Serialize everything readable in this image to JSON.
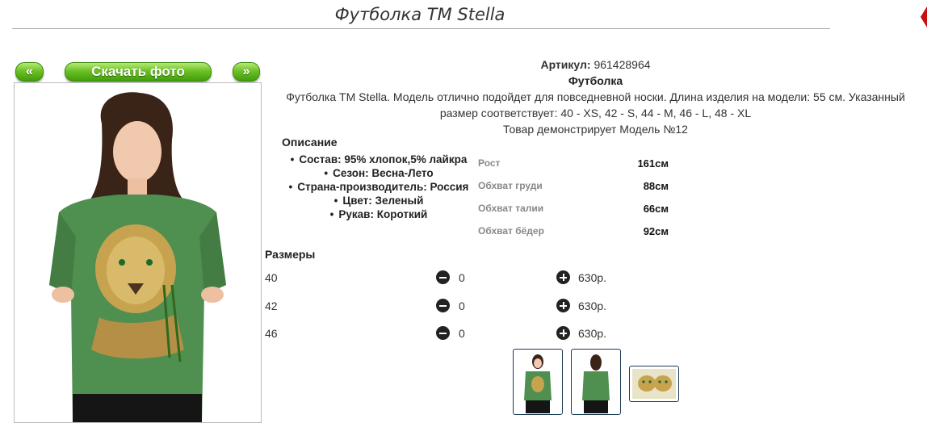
{
  "product": {
    "title": "Футболка ТМ Stella",
    "sku_label": "Артикул:",
    "sku_value": "961428964",
    "category": "Футболка",
    "description": "Футболка ТМ Stella. Модель отлично подойдет для повседневной носки. Длина изделия на модели: 55 см. Указанный размер соответствует: 40 - XS, 42 - S, 44 - M, 46 - L, 48 - XL",
    "model_note": "Товар демонстрирует Модель №12"
  },
  "photo_nav": {
    "prev_label": "«",
    "download_label": "Скачать фото",
    "next_label": "»"
  },
  "description_section": {
    "title": "Описание",
    "attributes": [
      "Состав: 95% хлопок,5% лайкра",
      "Сезон: Весна-Лето",
      "Страна-производитель: Россия",
      "Цвет: Зеленый",
      "Рукав: Короткий"
    ]
  },
  "model_measurements": [
    {
      "label": "Рост",
      "value": "161см"
    },
    {
      "label": "Обхват груди",
      "value": "88см"
    },
    {
      "label": "Обхват талии",
      "value": "66см"
    },
    {
      "label": "Обхват бёдер",
      "value": "92см"
    }
  ],
  "sizes_section": {
    "title": "Размеры",
    "rows": [
      {
        "size": "40",
        "qty": "0",
        "price": "630р."
      },
      {
        "size": "42",
        "qty": "0",
        "price": "630р."
      },
      {
        "size": "46",
        "qty": "0",
        "price": "630р."
      }
    ]
  },
  "colors": {
    "button_green": "#6cc126",
    "shirt_green": "#4f8f4f",
    "thumb_border": "#1a3a55"
  },
  "icons": {
    "minus": "minus-circle-icon",
    "plus": "plus-circle-icon"
  }
}
